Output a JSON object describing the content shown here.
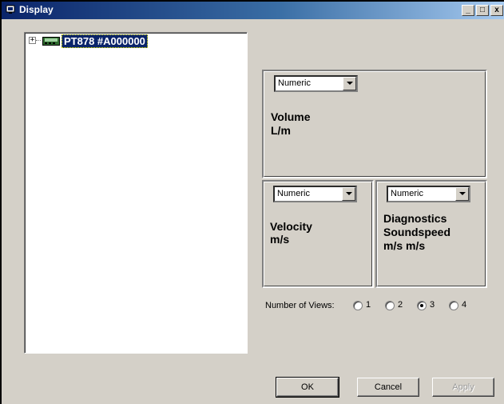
{
  "window": {
    "title": "Display",
    "minimize_glyph": "_",
    "maximize_glyph": "□",
    "close_glyph": "x"
  },
  "tree": {
    "expander_glyph": "+",
    "device_label": "PT878 #A000000"
  },
  "views": {
    "top": {
      "mode": "Numeric",
      "line1": "Volume",
      "line2": "L/m",
      "line3": ""
    },
    "bottom_left": {
      "mode": "Numeric",
      "line1": "Velocity",
      "line2": "m/s",
      "line3": ""
    },
    "bottom_right": {
      "mode": "Numeric",
      "line1": "Diagnostics",
      "line2": "Soundspeed",
      "line3": "m/s m/s"
    }
  },
  "number_of_views": {
    "label": "Number of Views:",
    "options": [
      "1",
      "2",
      "3",
      "4"
    ],
    "selected": "3"
  },
  "buttons": {
    "ok": "OK",
    "cancel": "Cancel",
    "apply": "Apply"
  }
}
